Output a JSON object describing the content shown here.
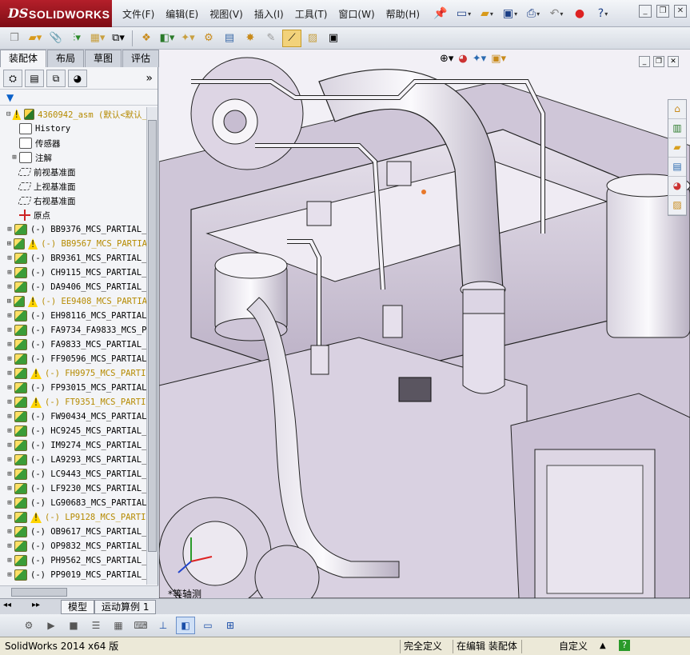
{
  "app": {
    "logo_ds": "DS",
    "logo_text": "SOLIDWORKS",
    "menu": [
      "文件(F)",
      "编辑(E)",
      "视图(V)",
      "插入(I)",
      "工具(T)",
      "窗口(W)",
      "帮助(H)"
    ]
  },
  "tabs": [
    "装配体",
    "布局",
    "草图",
    "评估"
  ],
  "tree": {
    "root": "4360942_asm  (默认<默认_",
    "fixed": [
      {
        "label": "History",
        "icon": "history-icon",
        "exp": ""
      },
      {
        "label": "传感器",
        "icon": "sensor-icon",
        "exp": ""
      },
      {
        "label": "注解",
        "icon": "annotation-icon",
        "exp": "⊞"
      },
      {
        "label": "前视基准面",
        "icon": "plane-icon",
        "exp": ""
      },
      {
        "label": "上视基准面",
        "icon": "plane-icon",
        "exp": ""
      },
      {
        "label": "右视基准面",
        "icon": "plane-icon",
        "exp": ""
      },
      {
        "label": "原点",
        "icon": "origin-icon",
        "exp": ""
      }
    ],
    "parts": [
      {
        "label": "(-) BB9376_MCS_PARTIAL_",
        "warn": false
      },
      {
        "label": "(-) BB9567_MCS_PARTIA",
        "warn": true
      },
      {
        "label": "(-) BR9361_MCS_PARTIAL_",
        "warn": false
      },
      {
        "label": "(-) CH9115_MCS_PARTIAL_",
        "warn": false
      },
      {
        "label": "(-) DA9406_MCS_PARTIAL_",
        "warn": false
      },
      {
        "label": "(-) EE9408_MCS_PARTIA",
        "warn": true
      },
      {
        "label": "(-) EH98116_MCS_PARTIAL",
        "warn": false
      },
      {
        "label": "(-) FA9734_FA9833_MCS_P",
        "warn": false
      },
      {
        "label": "(-) FA9833_MCS_PARTIAL_",
        "warn": false
      },
      {
        "label": "(-) FF90596_MCS_PARTIAL",
        "warn": false
      },
      {
        "label": "(-) FH9975_MCS_PARTI",
        "warn": true
      },
      {
        "label": "(-) FP93015_MCS_PARTIAL",
        "warn": false
      },
      {
        "label": "(-) FT9351_MCS_PARTI",
        "warn": true
      },
      {
        "label": "(-) FW90434_MCS_PARTIAL",
        "warn": false
      },
      {
        "label": "(-) HC9245_MCS_PARTIAL_",
        "warn": false
      },
      {
        "label": "(-) IM9274_MCS_PARTIAL_",
        "warn": false
      },
      {
        "label": "(-) LA9293_MCS_PARTIAL_",
        "warn": false
      },
      {
        "label": "(-) LC9443_MCS_PARTIAL_",
        "warn": false
      },
      {
        "label": "(-) LF9230_MCS_PARTIAL_",
        "warn": false
      },
      {
        "label": "(-) LG90683_MCS_PARTIAL",
        "warn": false
      },
      {
        "label": "(-) LP9128_MCS_PARTI",
        "warn": true
      },
      {
        "label": "(-) OB9617_MCS_PARTIAL_",
        "warn": false
      },
      {
        "label": "(-) OP9832_MCS_PARTIAL_",
        "warn": false
      },
      {
        "label": "(-) PH9562_MCS_PARTIAL_",
        "warn": false
      },
      {
        "label": "(-) PP9019_MCS_PARTIAL_",
        "warn": false
      }
    ]
  },
  "graphics": {
    "view_label": "*等轴测"
  },
  "bottom_tabs": [
    "模型",
    "运动算例 1"
  ],
  "status": {
    "app_version": "SolidWorks 2014 x64 版",
    "definition": "完全定义",
    "editing": "在编辑 装配体",
    "custom": "自定义",
    "help": "?"
  }
}
